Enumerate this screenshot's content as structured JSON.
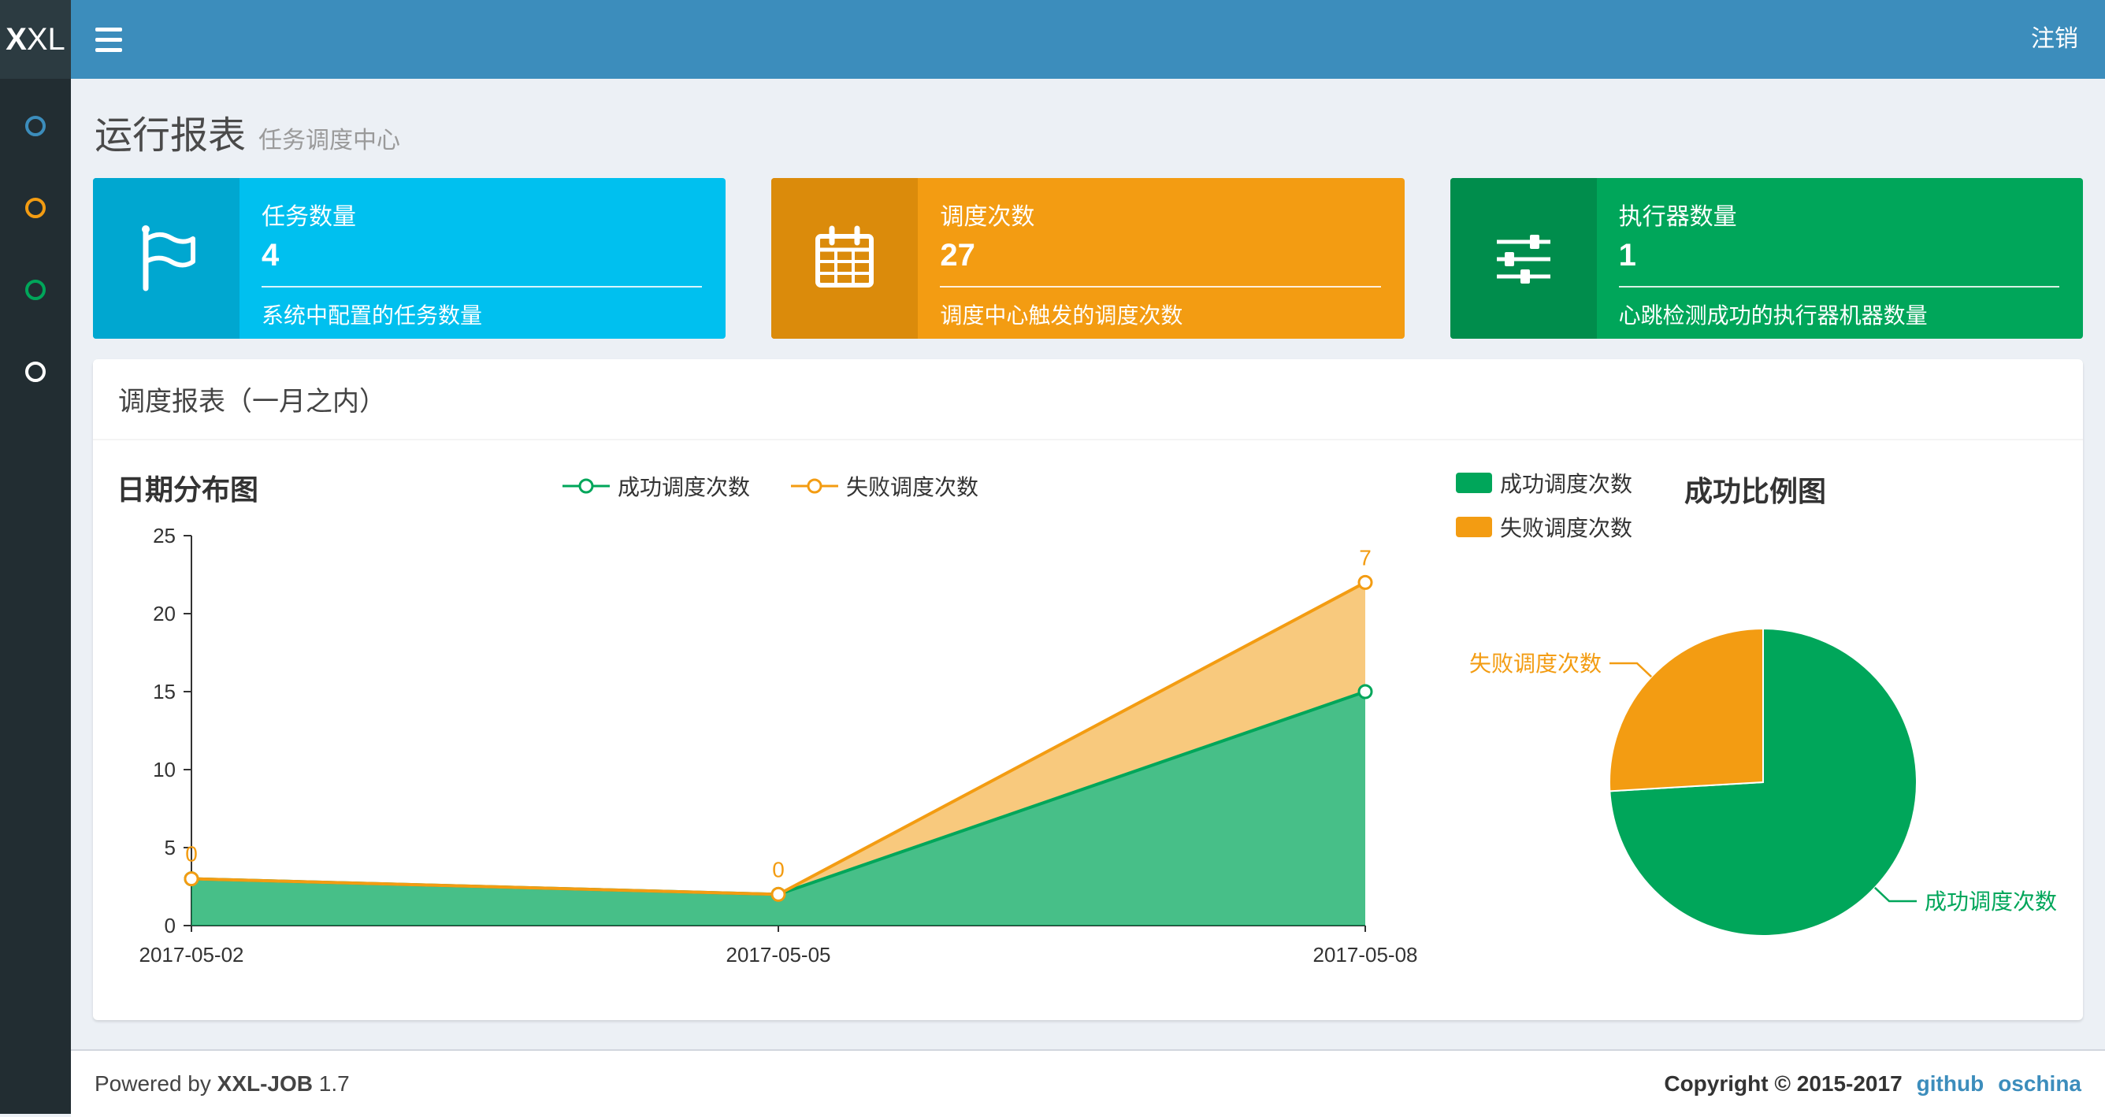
{
  "navbar": {
    "logo_bold": "X",
    "logo_rest": "XL",
    "logout": "注销"
  },
  "sidebar": {
    "items": [
      {
        "icon": "circle-icon",
        "color": "#3c8dbc"
      },
      {
        "icon": "circle-icon",
        "color": "#f39c12"
      },
      {
        "icon": "circle-icon",
        "color": "#00a65a"
      },
      {
        "icon": "circle-icon",
        "color": "#ffffff"
      }
    ]
  },
  "page_header": {
    "title": "运行报表",
    "subtitle": "任务调度中心"
  },
  "info_boxes": [
    {
      "label": "任务数量",
      "value": "4",
      "desc": "系统中配置的任务数量",
      "bg": "#00c0ef",
      "icon_bg": "#00a7d0",
      "icon": "flag-icon"
    },
    {
      "label": "调度次数",
      "value": "27",
      "desc": "调度中心触发的调度次数",
      "bg": "#f39c12",
      "icon_bg": "#db8b0b",
      "icon": "calendar-icon"
    },
    {
      "label": "执行器数量",
      "value": "1",
      "desc": "心跳检测成功的执行器机器数量",
      "bg": "#00a65a",
      "icon_bg": "#008d4c",
      "icon": "sliders-icon"
    }
  ],
  "panel": {
    "title": "调度报表（一月之内）"
  },
  "chart_data": [
    {
      "type": "area",
      "title": "日期分布图",
      "x": [
        "2017-05-02",
        "2017-05-05",
        "2017-05-08"
      ],
      "stacked": true,
      "series": [
        {
          "name": "成功调度次数",
          "color": "#00a65a",
          "values": [
            3,
            2,
            15
          ]
        },
        {
          "name": "失败调度次数",
          "color": "#f39c12",
          "values": [
            0,
            0,
            7
          ],
          "labels": [
            "0",
            "0",
            "7"
          ]
        }
      ],
      "ylim": [
        0,
        25
      ],
      "yticks": [
        0,
        5,
        10,
        15,
        20,
        25
      ],
      "legend_position": "top",
      "grid": false
    },
    {
      "type": "pie",
      "title": "成功比例图",
      "slices": [
        {
          "name": "成功调度次数",
          "value": 20,
          "color": "#00a65a"
        },
        {
          "name": "失败调度次数",
          "value": 7,
          "color": "#f39c12"
        }
      ],
      "legend_position": "top-left"
    }
  ],
  "footer": {
    "powered_prefix": "Powered by",
    "powered_brand": "XXL-JOB",
    "version": "1.7",
    "copyright": "Copyright © 2015-2017",
    "links": [
      "github",
      "oschina"
    ]
  }
}
